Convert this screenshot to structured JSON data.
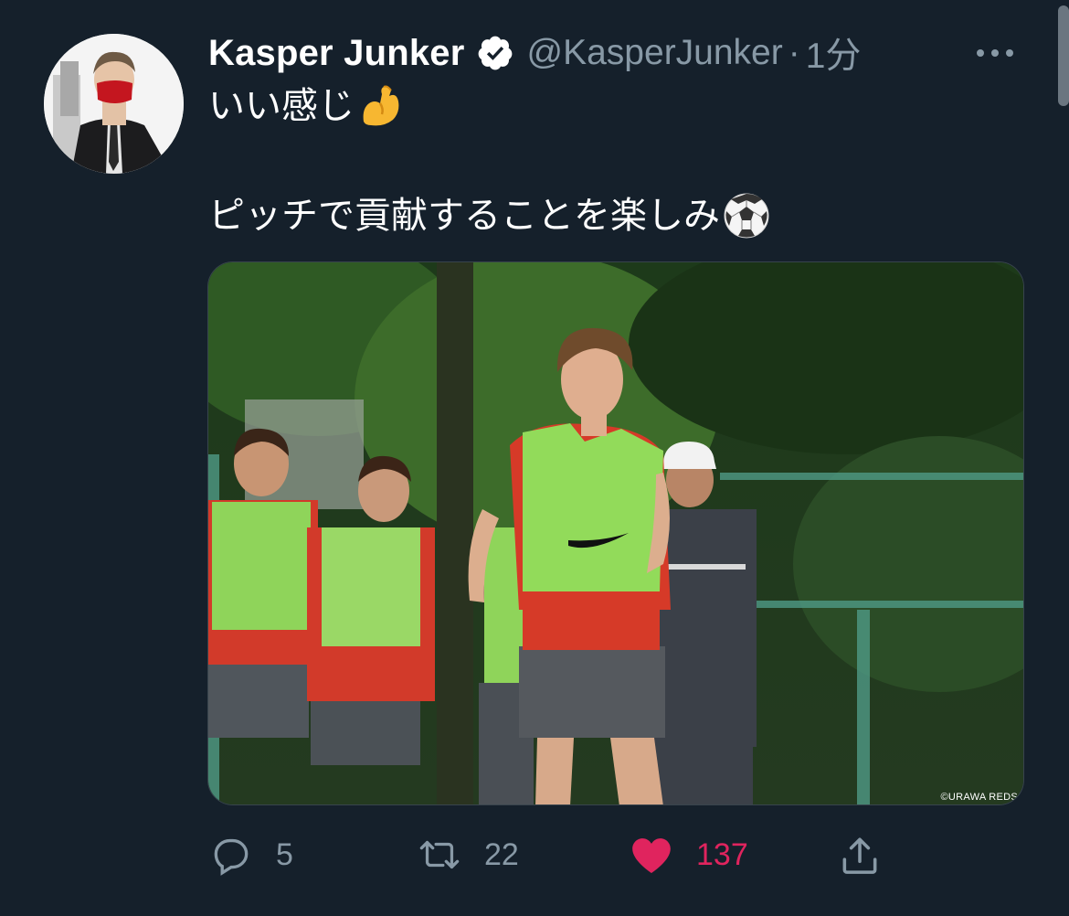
{
  "tweet": {
    "display_name": "Kasper Junker",
    "handle": "@KasperJunker",
    "separator": "·",
    "time": "1分",
    "text_line_1": "いい感じ",
    "text_line_2": "ピッチで貢献することを楽しみ",
    "emoji_1": "flexed-biceps",
    "emoji_2": "soccer-ball",
    "image_credit": "©URAWA REDS"
  },
  "actions": {
    "replies": "5",
    "retweets": "22",
    "likes": "137"
  },
  "colors": {
    "background": "#15202b",
    "secondary_text": "#8899a6",
    "like_accent": "#e0245e",
    "verified_badge": "#ffffff"
  }
}
